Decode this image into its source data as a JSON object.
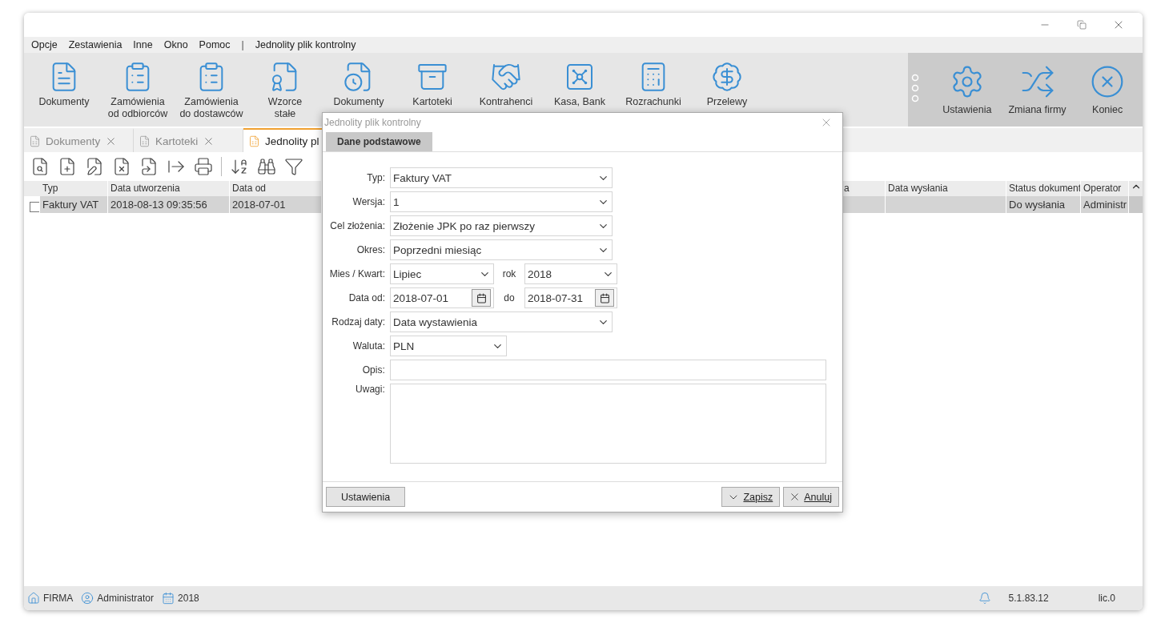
{
  "menu": [
    {
      "label": "Opcje",
      "kind": "item"
    },
    {
      "label": "Zestawienia",
      "kind": "item"
    },
    {
      "label": "Inne",
      "kind": "item"
    },
    {
      "label": "Okno",
      "kind": "item"
    },
    {
      "label": "Pomoc",
      "kind": "item"
    },
    {
      "label": "|",
      "kind": "separator"
    },
    {
      "label": "Jednolity plik kontrolny",
      "kind": "item"
    }
  ],
  "ribbon": {
    "items": [
      {
        "label": "Dokumenty"
      },
      {
        "label": "Zamówienia\nod odbiorców"
      },
      {
        "label": "Zamówienia\ndo dostawców"
      },
      {
        "label": "Wzorce\nstałe"
      },
      {
        "label": "Dokumenty"
      },
      {
        "label": "Kartoteki"
      },
      {
        "label": "Kontrahenci"
      },
      {
        "label": "Kasa, Bank"
      },
      {
        "label": "Rozrachunki"
      },
      {
        "label": "Przelewy"
      }
    ],
    "right_items": [
      {
        "label": "Ustawienia"
      },
      {
        "label": "Zmiana firmy"
      },
      {
        "label": "Koniec"
      }
    ]
  },
  "tabs": [
    {
      "label": "Dokumenty",
      "selected": false,
      "closable": true
    },
    {
      "label": "Kartoteki",
      "selected": false,
      "closable": true
    },
    {
      "label": "Jednolity pl",
      "selected": true,
      "closable": false
    }
  ],
  "table": {
    "columns": [
      "Typ",
      "Data utworzenia",
      "Data od",
      "a",
      "Data wysłania",
      "Status dokument",
      "Operator"
    ],
    "rows": [
      {
        "checked": false,
        "selected": true,
        "values": {
          "typ": "Faktury VAT",
          "created": "2018-08-13 09:35:56",
          "from": "2018-07-01",
          "status": "Do wysłania",
          "operator": "Administr"
        }
      }
    ]
  },
  "dialog": {
    "title": "Jednolity plik kontrolny",
    "tabs": [
      {
        "label": "Dane podstawowe",
        "selected": true
      }
    ],
    "fields": [
      {
        "kind": "select",
        "label": "Typ:",
        "value": "Faktury VAT"
      },
      {
        "kind": "select",
        "label": "Wersja:",
        "value": "1"
      },
      {
        "kind": "select",
        "label": "Cel złożenia:",
        "value": "Złożenie JPK po raz pierwszy"
      },
      {
        "kind": "select",
        "label": "Okres:",
        "value": "Poprzedni miesiąc"
      },
      {
        "kind": "select-pair",
        "label": "Mies / Kwart:",
        "value": "Lipiec",
        "second_label": "rok",
        "second_value": "2018"
      },
      {
        "kind": "date-pair",
        "label": "Data od:",
        "value": "2018-07-01",
        "second_label": "do",
        "second_value": "2018-07-31"
      },
      {
        "kind": "select",
        "label": "Rodzaj daty:",
        "value": "Data wystawienia"
      },
      {
        "kind": "select-short",
        "label": "Waluta:",
        "value": "PLN"
      },
      {
        "kind": "text",
        "label": "Opis:"
      },
      {
        "kind": "textarea",
        "label": "Uwagi:"
      }
    ],
    "left_button": "Ustawienia",
    "buttons": [
      {
        "label": "Zapisz",
        "kind": "confirm"
      },
      {
        "label": "Anuluj",
        "kind": "cancel"
      }
    ]
  },
  "status_bar": {
    "company": "FIRMA",
    "user": "Administrator",
    "year": "2018",
    "version": "5.1.83.12",
    "license": "lic.0"
  }
}
